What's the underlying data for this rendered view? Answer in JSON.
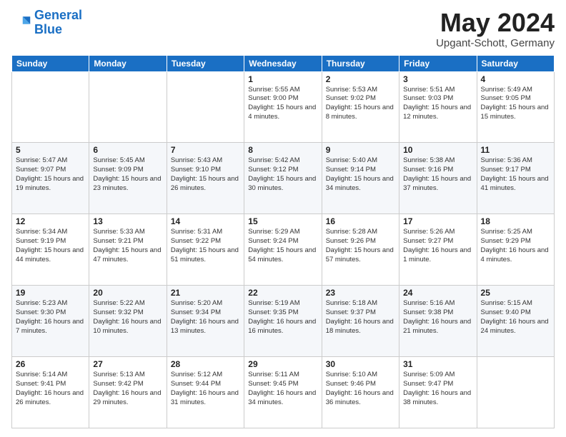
{
  "logo": {
    "line1": "General",
    "line2": "Blue"
  },
  "title": "May 2024",
  "subtitle": "Upgant-Schott, Germany",
  "days_of_week": [
    "Sunday",
    "Monday",
    "Tuesday",
    "Wednesday",
    "Thursday",
    "Friday",
    "Saturday"
  ],
  "weeks": [
    [
      {
        "day": "",
        "info": ""
      },
      {
        "day": "",
        "info": ""
      },
      {
        "day": "",
        "info": ""
      },
      {
        "day": "1",
        "info": "Sunrise: 5:55 AM\nSunset: 9:00 PM\nDaylight: 15 hours and 4 minutes."
      },
      {
        "day": "2",
        "info": "Sunrise: 5:53 AM\nSunset: 9:02 PM\nDaylight: 15 hours and 8 minutes."
      },
      {
        "day": "3",
        "info": "Sunrise: 5:51 AM\nSunset: 9:03 PM\nDaylight: 15 hours and 12 minutes."
      },
      {
        "day": "4",
        "info": "Sunrise: 5:49 AM\nSunset: 9:05 PM\nDaylight: 15 hours and 15 minutes."
      }
    ],
    [
      {
        "day": "5",
        "info": "Sunrise: 5:47 AM\nSunset: 9:07 PM\nDaylight: 15 hours and 19 minutes."
      },
      {
        "day": "6",
        "info": "Sunrise: 5:45 AM\nSunset: 9:09 PM\nDaylight: 15 hours and 23 minutes."
      },
      {
        "day": "7",
        "info": "Sunrise: 5:43 AM\nSunset: 9:10 PM\nDaylight: 15 hours and 26 minutes."
      },
      {
        "day": "8",
        "info": "Sunrise: 5:42 AM\nSunset: 9:12 PM\nDaylight: 15 hours and 30 minutes."
      },
      {
        "day": "9",
        "info": "Sunrise: 5:40 AM\nSunset: 9:14 PM\nDaylight: 15 hours and 34 minutes."
      },
      {
        "day": "10",
        "info": "Sunrise: 5:38 AM\nSunset: 9:16 PM\nDaylight: 15 hours and 37 minutes."
      },
      {
        "day": "11",
        "info": "Sunrise: 5:36 AM\nSunset: 9:17 PM\nDaylight: 15 hours and 41 minutes."
      }
    ],
    [
      {
        "day": "12",
        "info": "Sunrise: 5:34 AM\nSunset: 9:19 PM\nDaylight: 15 hours and 44 minutes."
      },
      {
        "day": "13",
        "info": "Sunrise: 5:33 AM\nSunset: 9:21 PM\nDaylight: 15 hours and 47 minutes."
      },
      {
        "day": "14",
        "info": "Sunrise: 5:31 AM\nSunset: 9:22 PM\nDaylight: 15 hours and 51 minutes."
      },
      {
        "day": "15",
        "info": "Sunrise: 5:29 AM\nSunset: 9:24 PM\nDaylight: 15 hours and 54 minutes."
      },
      {
        "day": "16",
        "info": "Sunrise: 5:28 AM\nSunset: 9:26 PM\nDaylight: 15 hours and 57 minutes."
      },
      {
        "day": "17",
        "info": "Sunrise: 5:26 AM\nSunset: 9:27 PM\nDaylight: 16 hours and 1 minute."
      },
      {
        "day": "18",
        "info": "Sunrise: 5:25 AM\nSunset: 9:29 PM\nDaylight: 16 hours and 4 minutes."
      }
    ],
    [
      {
        "day": "19",
        "info": "Sunrise: 5:23 AM\nSunset: 9:30 PM\nDaylight: 16 hours and 7 minutes."
      },
      {
        "day": "20",
        "info": "Sunrise: 5:22 AM\nSunset: 9:32 PM\nDaylight: 16 hours and 10 minutes."
      },
      {
        "day": "21",
        "info": "Sunrise: 5:20 AM\nSunset: 9:34 PM\nDaylight: 16 hours and 13 minutes."
      },
      {
        "day": "22",
        "info": "Sunrise: 5:19 AM\nSunset: 9:35 PM\nDaylight: 16 hours and 16 minutes."
      },
      {
        "day": "23",
        "info": "Sunrise: 5:18 AM\nSunset: 9:37 PM\nDaylight: 16 hours and 18 minutes."
      },
      {
        "day": "24",
        "info": "Sunrise: 5:16 AM\nSunset: 9:38 PM\nDaylight: 16 hours and 21 minutes."
      },
      {
        "day": "25",
        "info": "Sunrise: 5:15 AM\nSunset: 9:40 PM\nDaylight: 16 hours and 24 minutes."
      }
    ],
    [
      {
        "day": "26",
        "info": "Sunrise: 5:14 AM\nSunset: 9:41 PM\nDaylight: 16 hours and 26 minutes."
      },
      {
        "day": "27",
        "info": "Sunrise: 5:13 AM\nSunset: 9:42 PM\nDaylight: 16 hours and 29 minutes."
      },
      {
        "day": "28",
        "info": "Sunrise: 5:12 AM\nSunset: 9:44 PM\nDaylight: 16 hours and 31 minutes."
      },
      {
        "day": "29",
        "info": "Sunrise: 5:11 AM\nSunset: 9:45 PM\nDaylight: 16 hours and 34 minutes."
      },
      {
        "day": "30",
        "info": "Sunrise: 5:10 AM\nSunset: 9:46 PM\nDaylight: 16 hours and 36 minutes."
      },
      {
        "day": "31",
        "info": "Sunrise: 5:09 AM\nSunset: 9:47 PM\nDaylight: 16 hours and 38 minutes."
      },
      {
        "day": "",
        "info": ""
      }
    ]
  ]
}
